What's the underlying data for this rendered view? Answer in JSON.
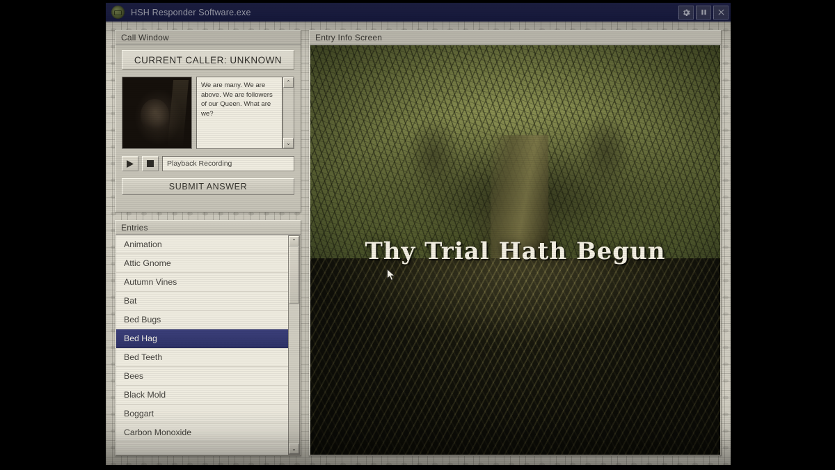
{
  "window": {
    "title": "HSH Responder Software.exe",
    "icon": "app-orb-icon",
    "controls": [
      {
        "name": "settings",
        "icon": "gear-icon",
        "label": "⚙"
      },
      {
        "name": "pause",
        "icon": "pause-icon",
        "label": "⏸"
      },
      {
        "name": "close",
        "icon": "close-icon",
        "label": "✕"
      }
    ]
  },
  "call_window": {
    "panel_title": "Call Window",
    "caller_banner": "CURRENT CALLER: UNKNOWN",
    "portrait_alt": "caller-portrait-dark-figure",
    "transcript": "We are many. We are above. We are followers of our Queen. What are we?",
    "playback": {
      "play_label": "▶",
      "stop_label": "■",
      "field_text": "Playback Recording"
    },
    "submit_label": "SUBMIT ANSWER",
    "scroll": {
      "up_label": "⌃",
      "down_label": "⌄"
    }
  },
  "entries": {
    "panel_title": "Entries",
    "selected": "Bed Hag",
    "items": [
      "Animation",
      "Attic Gnome",
      "Autumn Vines",
      "Bat",
      "Bed Bugs",
      "Bed Hag",
      "Bed Teeth",
      "Bees",
      "Black Mold",
      "Boggart",
      "Carbon Monoxide"
    ],
    "scroll": {
      "up_label": "⌃",
      "down_label": "⌄"
    }
  },
  "entry_info": {
    "panel_title": "Entry Info Screen",
    "artwork_alt": "great-tree-with-sprawling-roots",
    "overlay_text": "Thy Trial Hath Begun"
  },
  "colors": {
    "titlebar": "#262a5c",
    "chrome": "#c6c3b7",
    "panel_face": "#efece0",
    "selection": "#343873",
    "artwork_green": "#7f874a",
    "overlay_text": "#f3efe2"
  }
}
